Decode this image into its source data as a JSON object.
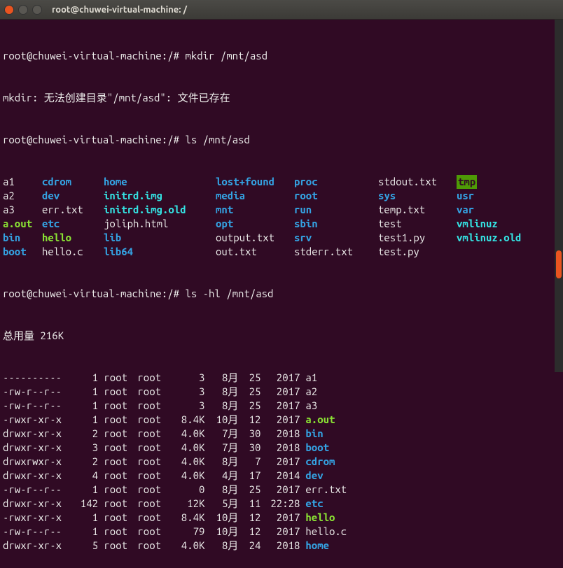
{
  "window": {
    "title": "root@chuwei-virtual-machine: /"
  },
  "prompt": "root@chuwei-virtual-machine:/#",
  "commands": {
    "c1": "mkdir /mnt/asd",
    "err1": "mkdir: 无法创建目录\"/mnt/asd\": 文件已存在",
    "c2": "ls /mnt/asd",
    "c3": "ls -hl /mnt/asd",
    "total": "总用量 216K"
  },
  "ls_cols": [
    [
      {
        "n": "a1",
        "c": "white"
      },
      {
        "n": "a2",
        "c": "white"
      },
      {
        "n": "a3",
        "c": "white"
      },
      {
        "n": "a.out",
        "c": "bgreen"
      },
      {
        "n": "bin",
        "c": "bblue"
      },
      {
        "n": "boot",
        "c": "bblue"
      }
    ],
    [
      {
        "n": "cdrom",
        "c": "bblue"
      },
      {
        "n": "dev",
        "c": "bblue"
      },
      {
        "n": "err.txt",
        "c": "white"
      },
      {
        "n": "etc",
        "c": "bblue"
      },
      {
        "n": "hello",
        "c": "bgreen"
      },
      {
        "n": "hello.c",
        "c": "white"
      }
    ],
    [
      {
        "n": "home",
        "c": "bblue"
      },
      {
        "n": "initrd.img",
        "c": "bcyan"
      },
      {
        "n": "initrd.img.old",
        "c": "bcyan"
      },
      {
        "n": "joliph.html",
        "c": "white"
      },
      {
        "n": "lib",
        "c": "bblue"
      },
      {
        "n": "lib64",
        "c": "bblue"
      }
    ],
    [
      {
        "n": "lost+found",
        "c": "bblue"
      },
      {
        "n": "media",
        "c": "bblue"
      },
      {
        "n": "mnt",
        "c": "bblue"
      },
      {
        "n": "opt",
        "c": "bblue"
      },
      {
        "n": "output.txt",
        "c": "white"
      },
      {
        "n": "out.txt",
        "c": "white"
      }
    ],
    [
      {
        "n": "proc",
        "c": "bblue"
      },
      {
        "n": "root",
        "c": "bblue"
      },
      {
        "n": "run",
        "c": "bblue"
      },
      {
        "n": "sbin",
        "c": "bblue"
      },
      {
        "n": "srv",
        "c": "bblue"
      },
      {
        "n": "stderr.txt",
        "c": "white"
      }
    ],
    [
      {
        "n": "stdout.txt",
        "c": "white"
      },
      {
        "n": "sys",
        "c": "bblue"
      },
      {
        "n": "temp.txt",
        "c": "white"
      },
      {
        "n": "test",
        "c": "white"
      },
      {
        "n": "test1.py",
        "c": "white"
      },
      {
        "n": "test.py",
        "c": "white"
      }
    ],
    [
      {
        "n": "tmp",
        "c": "tmp"
      },
      {
        "n": "usr",
        "c": "bblue"
      },
      {
        "n": "var",
        "c": "bblue"
      },
      {
        "n": "vmlinuz",
        "c": "bcyan"
      },
      {
        "n": "vmlinuz.old",
        "c": "bcyan"
      },
      {
        "n": "",
        "c": "white"
      }
    ]
  ],
  "ls_long": [
    {
      "perm": "----------",
      "links": "1",
      "owner": "root",
      "group": "root",
      "size": "3",
      "mon": "8月",
      "day": "25",
      "time": "2017",
      "name": "a1",
      "c": "white"
    },
    {
      "perm": "-rw-r--r--",
      "links": "1",
      "owner": "root",
      "group": "root",
      "size": "3",
      "mon": "8月",
      "day": "25",
      "time": "2017",
      "name": "a2",
      "c": "white"
    },
    {
      "perm": "-rw-r--r--",
      "links": "1",
      "owner": "root",
      "group": "root",
      "size": "3",
      "mon": "8月",
      "day": "25",
      "time": "2017",
      "name": "a3",
      "c": "white"
    },
    {
      "perm": "-rwxr-xr-x",
      "links": "1",
      "owner": "root",
      "group": "root",
      "size": "8.4K",
      "mon": "10月",
      "day": "12",
      "time": "2017",
      "name": "a.out",
      "c": "bgreen"
    },
    {
      "perm": "drwxr-xr-x",
      "links": "2",
      "owner": "root",
      "group": "root",
      "size": "4.0K",
      "mon": "7月",
      "day": "30",
      "time": "2018",
      "name": "bin",
      "c": "bblue"
    },
    {
      "perm": "drwxr-xr-x",
      "links": "3",
      "owner": "root",
      "group": "root",
      "size": "4.0K",
      "mon": "7月",
      "day": "30",
      "time": "2018",
      "name": "boot",
      "c": "bblue"
    },
    {
      "perm": "drwxrwxr-x",
      "links": "2",
      "owner": "root",
      "group": "root",
      "size": "4.0K",
      "mon": "8月",
      "day": "7",
      "time": "2017",
      "name": "cdrom",
      "c": "bblue"
    },
    {
      "perm": "drwxr-xr-x",
      "links": "4",
      "owner": "root",
      "group": "root",
      "size": "4.0K",
      "mon": "4月",
      "day": "17",
      "time": "2014",
      "name": "dev",
      "c": "bblue"
    },
    {
      "perm": "-rw-r--r--",
      "links": "1",
      "owner": "root",
      "group": "root",
      "size": "0",
      "mon": "8月",
      "day": "25",
      "time": "2017",
      "name": "err.txt",
      "c": "white"
    },
    {
      "perm": "drwxr-xr-x",
      "links": "142",
      "owner": "root",
      "group": "root",
      "size": "12K",
      "mon": "5月",
      "day": "11",
      "time": "22:28",
      "name": "etc",
      "c": "bblue"
    },
    {
      "perm": "-rwxr-xr-x",
      "links": "1",
      "owner": "root",
      "group": "root",
      "size": "8.4K",
      "mon": "10月",
      "day": "12",
      "time": "2017",
      "name": "hello",
      "c": "bgreen"
    },
    {
      "perm": "-rw-r--r--",
      "links": "1",
      "owner": "root",
      "group": "root",
      "size": "79",
      "mon": "10月",
      "day": "12",
      "time": "2017",
      "name": "hello.c",
      "c": "white"
    },
    {
      "perm": "drwxr-xr-x",
      "links": "5",
      "owner": "root",
      "group": "root",
      "size": "4.0K",
      "mon": "8月",
      "day": "24",
      "time": "2018",
      "name": "home",
      "c": "bblue"
    }
  ]
}
